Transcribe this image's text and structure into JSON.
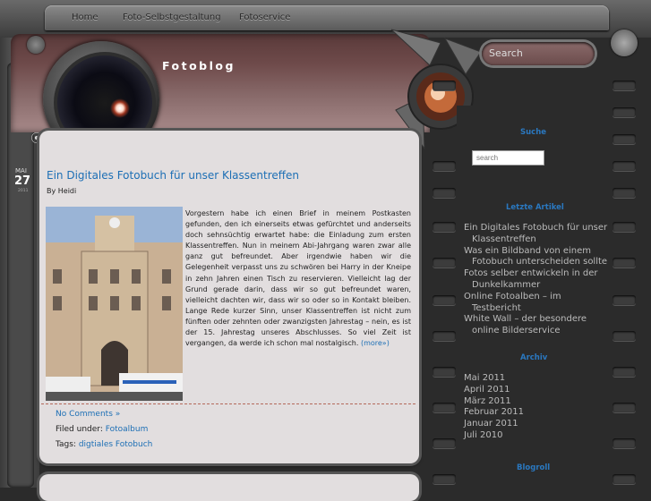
{
  "nav": {
    "items": [
      "Home",
      "Foto-Selbstgestaltung",
      "Fotoservice"
    ]
  },
  "header": {
    "title": "Fotoblog"
  },
  "search_top": {
    "placeholder": "Search"
  },
  "post": {
    "date": {
      "month": "MAI",
      "day": "27",
      "year": "2011"
    },
    "title": "Ein Digitales Fotobuch für unser Klassentreffen",
    "author": "By Heidi",
    "body": "Vorgestern habe ich einen Brief in meinem Postkasten gefunden, den ich einerseits etwas gefürchtet und anderseits doch sehnsüchtig erwartet habe: die Einladung zum ersten Klassentreffen. Nun in meinem Abi-Jahrgang waren zwar alle ganz gut befreundet. Aber irgendwie haben wir die Gelegenheit verpasst uns zu schwören bei Harry in der Kneipe in zehn Jahren einen Tisch zu reservieren. Vielleicht lag der Grund gerade darin, dass wir so gut befreundet waren, vielleicht dachten wir, dass wir so oder so in Kontakt bleiben. Lange Rede kurzer Sinn, unser Klassentreffen ist nicht zum fünften oder zehnten oder zwanzigsten Jahrestag – nein, es ist der 15. Jahrestag unseres Abschlusses. So viel Zeit ist vergangen, da werde ich schon mal nostalgisch.",
    "more": "(more»)",
    "comments": "No Comments »",
    "filed_label": "Filed under:",
    "filed_category": "Fotoalbum",
    "tags_label": "Tags:",
    "tags_value": "digtiales Fotobuch"
  },
  "sidebar": {
    "search_heading": "Suche",
    "search_placeholder": "search",
    "recent_heading": "Letzte Artikel",
    "recent": [
      {
        "l1": "Ein Digitales Fotobuch für unser",
        "l2": "Klassentreffen"
      },
      {
        "l1": "Was ein Bildband von einem",
        "l2": "Fotobuch unterscheiden sollte"
      },
      {
        "l1": "Fotos selber entwickeln in der",
        "l2": "Dunkelkammer"
      },
      {
        "l1": "Online Fotoalben – im",
        "l2": "Testbericht"
      },
      {
        "l1": "White Wall – der besondere",
        "l2": "online Bilderservice"
      }
    ],
    "archive_heading": "Archiv",
    "archive": [
      "Mai 2011",
      "April 2011",
      "März 2011",
      "Februar 2011",
      "Januar 2011",
      "Juli 2010"
    ],
    "blogroll_heading": "Blogroll"
  },
  "colors": {
    "link": "#1d6fb5",
    "sidebar_heading": "#2a78c0",
    "panel": "#e2dedf",
    "background": "#2b2b2b"
  }
}
